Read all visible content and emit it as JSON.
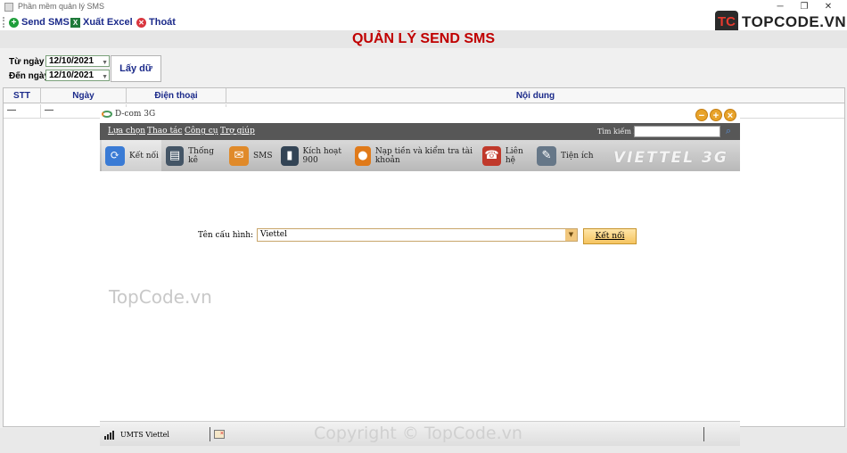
{
  "window": {
    "title": "Phần mềm quản lý SMS",
    "controls": {
      "minimize": "─",
      "maximize": "❐",
      "close": "✕"
    }
  },
  "toolbar": {
    "send_sms": "Send SMS",
    "export_excel": "Xuất Excel",
    "exit": "Thoát"
  },
  "brand": {
    "mark": "TC",
    "text": "TOPCODE.VN"
  },
  "heading": "QUẢN LÝ SEND SMS",
  "filters": {
    "from_label": "Từ ngày",
    "from_value": "12/10/2021",
    "to_label": "Đến ngày",
    "to_value": "12/10/2021",
    "fetch_button": "Lấy dữ liệu",
    "dropdown_glyph": "▼"
  },
  "grid": {
    "columns": [
      "STT",
      "Ngày",
      "Điện thoại",
      "Nội dung"
    ],
    "rows": [
      [
        "—",
        "—",
        "",
        ""
      ]
    ]
  },
  "dcom": {
    "title": "D-com 3G",
    "window_buttons": {
      "minimize": "−",
      "maximize": "+",
      "close": "×"
    },
    "menu": [
      "Lựa chọn",
      "Thao tác",
      "Công cụ",
      "Trợ giúp"
    ],
    "search_label": "Tìm kiếm lỗi",
    "tabs": [
      {
        "label": "Kết nối",
        "icon": "connect-icon",
        "color": "#3a7bd5",
        "glyph": "⟳"
      },
      {
        "label": "Thống kê",
        "icon": "statistics-icon",
        "color": "#445566",
        "glyph": "▤"
      },
      {
        "label": "SMS",
        "icon": "envelope-icon",
        "color": "#e08a2a",
        "glyph": "✉"
      },
      {
        "label": "Kích hoạt 900",
        "icon": "phone-icon",
        "color": "#334455",
        "glyph": "▮"
      },
      {
        "label": "Nạp tiền và kiểm tra tài khoản",
        "icon": "coin-icon",
        "color": "#e07a1a",
        "glyph": "●"
      },
      {
        "label": "Liên hệ",
        "icon": "telephone-icon",
        "color": "#c0392b",
        "glyph": "☎"
      },
      {
        "label": "Tiện ích",
        "icon": "tools-icon",
        "color": "#667788",
        "glyph": "✎"
      }
    ],
    "brand_text": "VIETTEL 3G",
    "config_label": "Tên cấu hình:",
    "config_value": "Viettel",
    "connect_button": "Kết nối",
    "network_label": "UMTS  Viettel"
  },
  "watermark": "TopCode.vn",
  "copyright": "Copyright © TopCode.vn"
}
